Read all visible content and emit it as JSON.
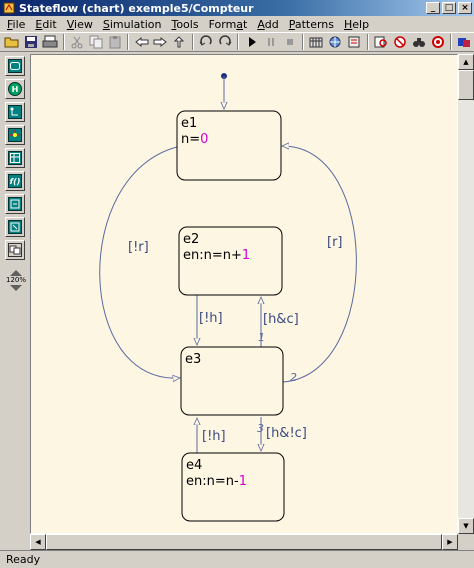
{
  "window": {
    "title": "Stateflow (chart) exemple5/Compteur"
  },
  "menu": [
    {
      "u": "F",
      "rest": "ile"
    },
    {
      "u": "E",
      "rest": "dit"
    },
    {
      "u": "V",
      "rest": "iew"
    },
    {
      "u": "S",
      "rest": "imulation"
    },
    {
      "u": "T",
      "rest": "ools"
    },
    {
      "pre": "Form",
      "u": "a",
      "rest": "t"
    },
    {
      "u": "A",
      "rest": "dd"
    },
    {
      "u": "P",
      "rest": "atterns"
    },
    {
      "u": "H",
      "rest": "elp"
    }
  ],
  "zoom": {
    "label": "120%"
  },
  "colors": {
    "canvas": "#fdf6e3",
    "value": "#d000d0",
    "transition": "#5a6aa0",
    "label": "#3a4a80"
  },
  "states": {
    "e1": {
      "name": "e1",
      "action_prefix": "n=",
      "action_value": "0"
    },
    "e2": {
      "name": "e2",
      "action_prefix": "en:n=n+",
      "action_value": "1"
    },
    "e3": {
      "name": "e3"
    },
    "e4": {
      "name": "e4",
      "action_prefix": "en:n=n-",
      "action_value": "1"
    }
  },
  "transitions": {
    "e1_to_e3": {
      "label": "[!r]"
    },
    "e3_to_e1": {
      "label": "[r]",
      "order": "2"
    },
    "e2_to_e3": {
      "label": "[!h]"
    },
    "e3_to_e2": {
      "label": "[h&c]",
      "order": "1"
    },
    "e3_to_e4": {
      "label": "[h&!c]",
      "order": "3"
    },
    "e4_to_e3": {
      "label": "[!h]"
    }
  },
  "status": {
    "text": "Ready"
  }
}
